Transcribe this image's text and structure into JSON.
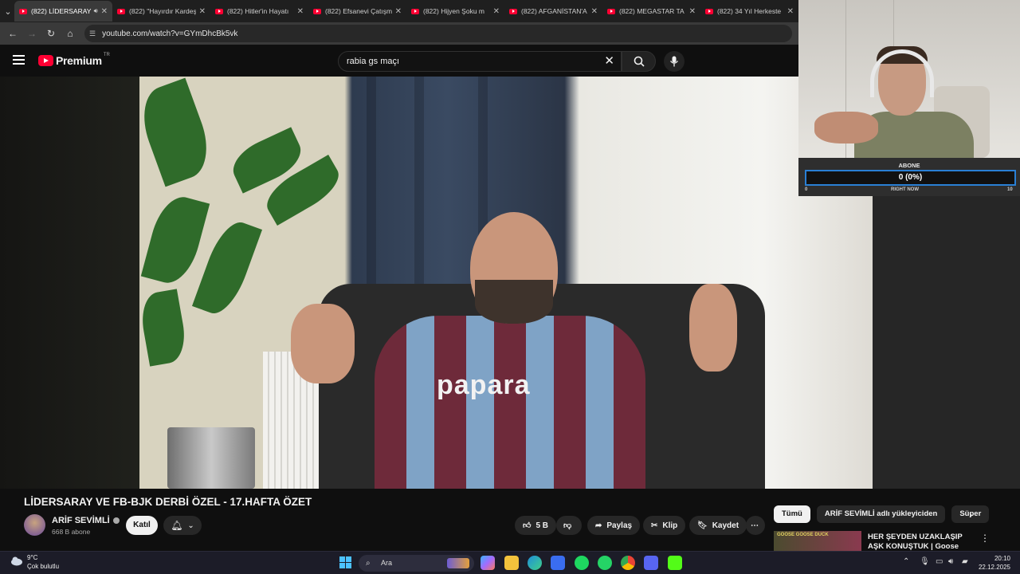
{
  "browser": {
    "tabs": [
      {
        "title": "(822) LİDERSARAY",
        "active": true
      },
      {
        "title": "(822) \"Hayırdır Kardeş"
      },
      {
        "title": "(822) Hitler'in Hayatı"
      },
      {
        "title": "(822) Efsanevi Çatışma"
      },
      {
        "title": "(822) Hijyen Şoku m"
      },
      {
        "title": "(822) AFGANİSTAN'A"
      },
      {
        "title": "(822) MEGASTAR TA"
      },
      {
        "title": "(822) 34 Yıl Herkeste"
      }
    ],
    "url": "youtube.com/watch?v=GYmDhcBk5vk"
  },
  "youtube": {
    "logo_text": "Premium",
    "country_code": "TR",
    "search_query": "rabia gs maçı"
  },
  "video": {
    "title": "LİDERSARAY VE FB-BJK DERBİ ÖZEL - 17.HAFTA ÖZET",
    "jersey_sponsor": "papara"
  },
  "channel": {
    "name": "ARİF SEVİMLİ",
    "subscribers": "668 B abone",
    "join_label": "Katıl"
  },
  "actions": {
    "likes": "5 B",
    "share": "Paylaş",
    "clip": "Klip",
    "save": "Kaydet"
  },
  "chips": [
    {
      "label": "Tümü",
      "selected": true
    },
    {
      "label": "ARİF SEVİMLİ adlı yükleyiciden"
    },
    {
      "label": "Süper"
    }
  ],
  "recommendation": {
    "title": "HER ŞEYDEN UZAKLAŞIP AŞK KONUŞTUK | Goose Goose",
    "thumb_text": "GOOSE GOOSE DUCK"
  },
  "sub_widget": {
    "label": "ABONE",
    "count": "0 (0%)",
    "left": "0",
    "center": "RIGHT NOW",
    "right": "10"
  },
  "taskbar": {
    "temperature": "9°C",
    "weather": "Çok bulutlu",
    "search_placeholder": "Ara",
    "time": "20:10",
    "date": "22.12.2025"
  },
  "colors": {
    "youtube_red": "#ff0033",
    "sub_bar_border": "#2a7fd4",
    "background": "#0f0f0f"
  }
}
